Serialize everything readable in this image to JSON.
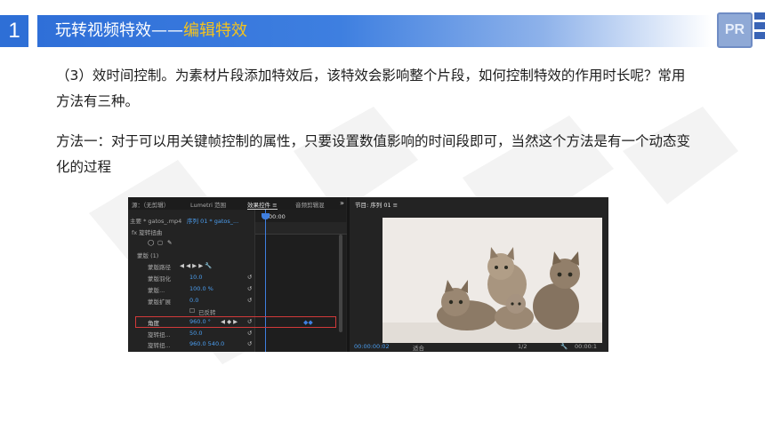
{
  "header": {
    "slide_number": "1",
    "title_main": "玩转视频特效——",
    "title_highlight": "编辑特效",
    "logo_text": "PR"
  },
  "body": {
    "para1": "（3）效时间控制。为素材片段添加特效后，该特效会影响整个片段，如何控制特效的作用时长呢？常用方法有三种。",
    "para2": "方法一：对于可以用关键帧控制的属性，只要设置数值影响的时间段即可，当然这个方法是有一个动态变化的过程"
  },
  "screenshot": {
    "tabs": [
      "源：（无剪辑）",
      "Lumetri 范围",
      "效果控件 ≡",
      "音频剪辑混"
    ],
    "monitor_tab": "节目: 序列 01  ≡",
    "source_label": "主要 * gatos_.mp4",
    "sequence_label": "序列 01 * gatos_...",
    "ruler_timecode": "00:00",
    "effect_name": "fx 旋转扭曲",
    "mask_label": "蒙版 (1)",
    "rows": [
      {
        "label": "蒙版路径",
        "value": ""
      },
      {
        "label": "蒙版羽化",
        "value": "10.0"
      },
      {
        "label": "蒙版...",
        "value": "100.0 %"
      },
      {
        "label": "蒙版扩展",
        "value": "0.0"
      },
      {
        "label": "已反转",
        "value": ""
      },
      {
        "label": "角度",
        "value": "960.0 °"
      },
      {
        "label": "旋转扭...",
        "value": "50.0"
      },
      {
        "label": "旋转扭...",
        "value": "960.0    540.0"
      }
    ],
    "monitor_timecode": "00:00:00:02",
    "fit_label": "适合",
    "zoom_label": "1/2",
    "end_timecode": "00:00:1"
  },
  "colors": {
    "accent_blue": "#2e6fd6",
    "highlight_yellow": "#f5c31c",
    "keyframe_box_red": "#d23a3a"
  }
}
